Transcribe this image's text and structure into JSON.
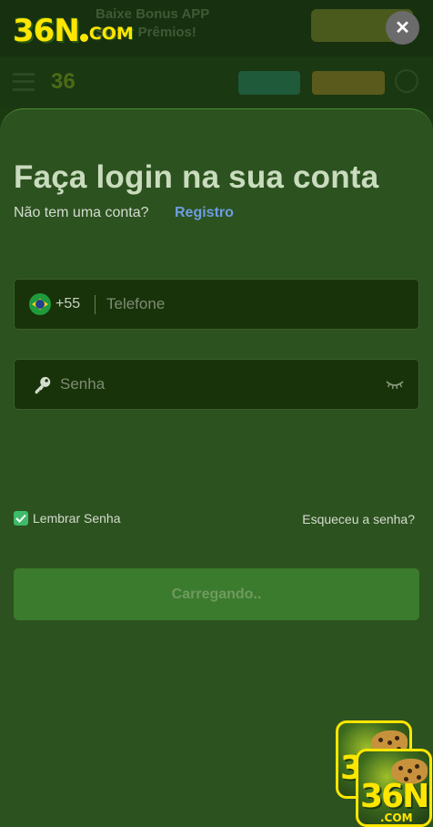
{
  "brand": {
    "logo_main": "36N",
    "logo_suffix": "COM"
  },
  "background": {
    "promo_text_line1": "Baixe Bonus APP",
    "promo_text_line2": "Super Prêmios!"
  },
  "login": {
    "title": "Faça login na sua conta",
    "no_account_text": "Não tem uma conta?",
    "register_label": "Registro",
    "phone": {
      "country_flag": "brazil-flag",
      "dial_code": "+55",
      "placeholder": "Telefone",
      "value": ""
    },
    "password": {
      "placeholder": "Senha",
      "value": ""
    },
    "remember_label": "Lembrar Senha",
    "remember_checked": true,
    "forgot_label": "Esqueceu a senha?",
    "submit_label": "Carregando.."
  },
  "promo_icon": {
    "text": "36N",
    "suffix": ".COM"
  },
  "colors": {
    "sheet_bg": "#2c521f",
    "field_bg": "#183309",
    "link": "#6e9de0",
    "checkbox": "#3dbb6a",
    "button_bg": "#3b7b2d",
    "logo_yellow": "#ffe600"
  }
}
